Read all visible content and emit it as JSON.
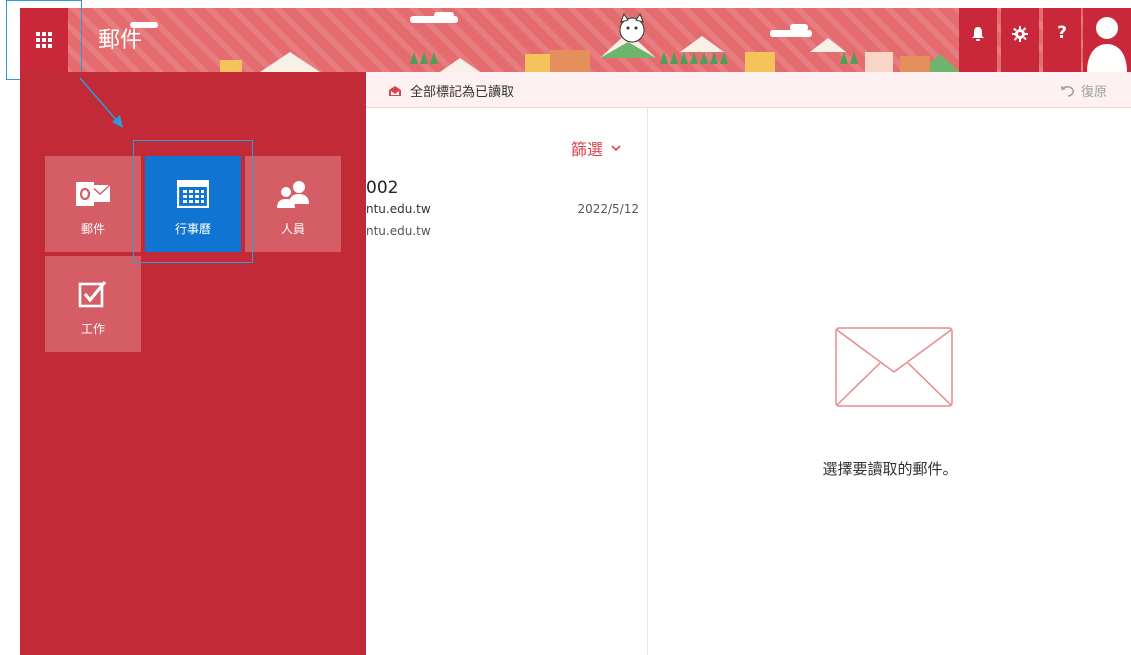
{
  "header": {
    "title": "郵件",
    "waffle_icon": "waffle-icon",
    "bell_icon": "bell-icon",
    "gear_icon": "gear-icon",
    "help_glyph": "?",
    "avatar_icon": "avatar-icon",
    "colors": {
      "band": "#e46b6e",
      "button": "#c8283a"
    }
  },
  "command_bar": {
    "mark_all_read": "全部標記為已讀取",
    "undo": "復原"
  },
  "message_list": {
    "filter_label": "篩選",
    "item": {
      "name_partial": "002",
      "from_partial": "ntu.edu.tw",
      "date": "2022/5/12",
      "line2_partial": "ntu.edu.tw"
    }
  },
  "reading_pane": {
    "empty_message": "選擇要讀取的郵件。"
  },
  "launcher": {
    "tiles": [
      {
        "label": "郵件",
        "icon": "outlook-mail-icon"
      },
      {
        "label": "行事曆",
        "icon": "calendar-icon",
        "active": true
      },
      {
        "label": "人員",
        "icon": "people-icon"
      },
      {
        "label": "工作",
        "icon": "task-checkbox-icon"
      }
    ],
    "colors": {
      "panel": "#c22a37",
      "tile": "#d45d66",
      "active_tile": "#0f74d2",
      "highlight": "#2e9bd8"
    }
  }
}
